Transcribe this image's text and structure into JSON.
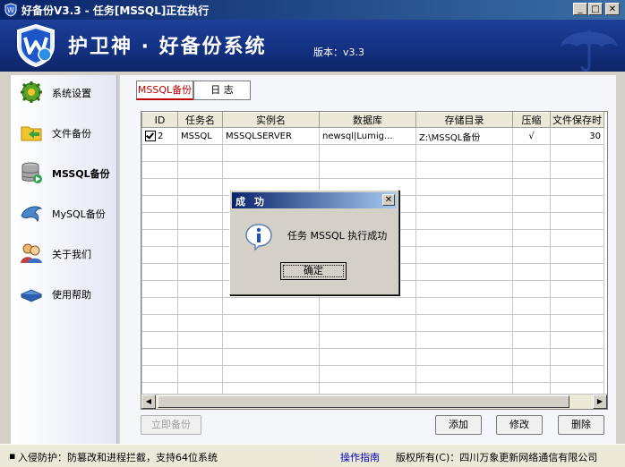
{
  "window": {
    "title": "好备份V3.3 - 任务[MSSQL]正在执行"
  },
  "banner": {
    "app_name": "护卫神 · 好备份系统",
    "version": "版本：v3.3"
  },
  "sidebar": {
    "items": [
      {
        "label": "系统设置",
        "icon": "gear-icon"
      },
      {
        "label": "文件备份",
        "icon": "folder-icon"
      },
      {
        "label": "MSSQL备份",
        "icon": "database-icon"
      },
      {
        "label": "MySQL备份",
        "icon": "dolphin-icon"
      },
      {
        "label": "关于我们",
        "icon": "people-icon"
      },
      {
        "label": "使用帮助",
        "icon": "book-icon"
      }
    ],
    "active": "MSSQL备份"
  },
  "tabs": [
    {
      "label": "MSSQL备份"
    },
    {
      "label": "日 志"
    }
  ],
  "table": {
    "columns": [
      "ID",
      "任务名",
      "实例名",
      "数据库",
      "存储目录",
      "压缩",
      "文件保存时"
    ],
    "rows": [
      {
        "id": "2",
        "task": "MSSQL",
        "instance": "MSSQLSERVER",
        "database": "newsql|Lumig...",
        "dir": "Z:\\MSSQL备份",
        "compress": "√",
        "keep": "30",
        "checked": true
      }
    ]
  },
  "buttons": {
    "backup_now": "立即备份",
    "add": "添加",
    "edit": "修改",
    "delete": "删除"
  },
  "status": {
    "left": "入侵防护：防篡改和进程拦截，支持64位系统",
    "guide": "操作指南",
    "copyright": "版权所有(C)：四川万象更新网络通信有限公司"
  },
  "dialog": {
    "title": "成 功",
    "message": "任务 MSSQL 执行成功",
    "ok": "确定"
  },
  "colors": {
    "banner": "#13307f",
    "accent_red": "#c00000",
    "link": "#0000c0"
  }
}
